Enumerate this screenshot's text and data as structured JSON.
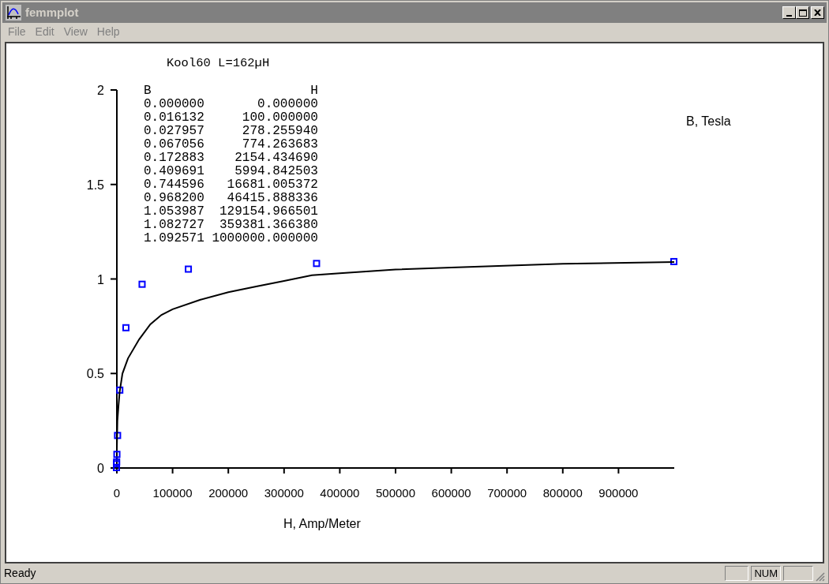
{
  "window": {
    "title": "femmplot"
  },
  "menu": [
    "File",
    "Edit",
    "View",
    "Help"
  ],
  "plot": {
    "chart_data": {
      "type": "scatter",
      "title": "Kool60 L=162µH",
      "xlabel": "H, Amp/Meter",
      "ylabel": "B, Tesla",
      "series": [
        {
          "type": "scatter",
          "color": "#0000ff",
          "x": [
            0,
            100,
            300,
            800,
            2000,
            6000,
            17000,
            46000,
            129000,
            359000,
            1000000
          ],
          "values": [
            0,
            0.02,
            0.03,
            0.07,
            0.17,
            0.41,
            0.74,
            0.97,
            1.05,
            1.08,
            1.09
          ]
        },
        {
          "type": "line",
          "color": "#000000",
          "x": [
            0,
            1000,
            3000,
            5000,
            10000,
            20000,
            40000,
            60000,
            80000,
            100000,
            150000,
            200000,
            250000,
            300000,
            350000,
            400000,
            500000,
            600000,
            800000,
            1000000
          ],
          "values": [
            0.1,
            0.25,
            0.33,
            0.4,
            0.5,
            0.58,
            0.68,
            0.76,
            0.81,
            0.84,
            0.89,
            0.93,
            0.96,
            0.99,
            1.02,
            1.03,
            1.05,
            1.06,
            1.08,
            1.09
          ]
        }
      ],
      "xlim": [
        0,
        1000000
      ],
      "ylim": [
        0,
        2
      ],
      "xticks": [
        0,
        100000,
        200000,
        300000,
        400000,
        500000,
        600000,
        700000,
        800000,
        900000
      ],
      "yticks": [
        0,
        0.5,
        1,
        1.5,
        2
      ]
    },
    "data_table": {
      "columns": [
        "B",
        "H"
      ],
      "rows": [
        [
          "0.000000",
          "0.000000"
        ],
        [
          "0.016132",
          "100.000000"
        ],
        [
          "0.027957",
          "278.255940"
        ],
        [
          "0.067056",
          "774.263683"
        ],
        [
          "0.172883",
          "2154.434690"
        ],
        [
          "0.409691",
          "5994.842503"
        ],
        [
          "0.744596",
          "16681.005372"
        ],
        [
          "0.968200",
          "46415.888336"
        ],
        [
          "1.053987",
          "129154.966501"
        ],
        [
          "1.082727",
          "359381.366380"
        ],
        [
          "1.092571",
          "1000000.000000"
        ]
      ]
    }
  },
  "status_bar": {
    "message": "Ready",
    "indicators": [
      "NUM"
    ]
  }
}
